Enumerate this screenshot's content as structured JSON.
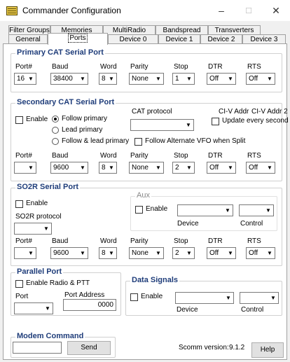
{
  "window": {
    "title": "Commander Configuration",
    "min": "–",
    "max": "☐",
    "close": "✕"
  },
  "tabs_back": [
    "Filter Groups",
    "Memories",
    "MultiRadio",
    "Bandspread",
    "Transverters"
  ],
  "tabs_front": [
    "General",
    "Ports",
    "Device 0",
    "Device 1",
    "Device 2",
    "Device 3"
  ],
  "primary": {
    "title": "Primary CAT Serial Port",
    "labels": [
      "Port#",
      "Baud",
      "Word",
      "Parity",
      "Stop",
      "DTR",
      "RTS"
    ],
    "values": [
      "16",
      "38400",
      "8",
      "None",
      "1",
      "Off",
      "Off"
    ]
  },
  "secondary": {
    "title": "Secondary CAT Serial Port",
    "enable": "Enable",
    "follow_primary": "Follow primary",
    "lead_primary": "Lead primary",
    "follow_lead": "Follow & lead primary",
    "cat_protocol": "CAT protocol",
    "civ1": "CI-V Addr",
    "civ2": "CI-V Addr 2",
    "update": "Update every second",
    "follow_vfo": "Follow Alternate VFO when Split",
    "labels": [
      "Port#",
      "Baud",
      "Word",
      "Parity",
      "Stop",
      "DTR",
      "RTS"
    ],
    "values": [
      "",
      "9600",
      "8",
      "None",
      "2",
      "Off",
      "Off"
    ]
  },
  "so2r": {
    "title": "SO2R Serial Port",
    "enable": "Enable",
    "protocol": "SO2R protocol",
    "aux": "Aux",
    "aux_enable": "Enable",
    "device": "Device",
    "control": "Control",
    "labels": [
      "Port#",
      "Baud",
      "Word",
      "Parity",
      "Stop",
      "DTR",
      "RTS"
    ],
    "values": [
      "",
      "9600",
      "8",
      "None",
      "2",
      "Off",
      "Off"
    ]
  },
  "parallel": {
    "title": "Parallel Port",
    "enable": "Enable Radio & PTT",
    "port": "Port",
    "address_label": "Port Address",
    "address": "0000"
  },
  "data_signals": {
    "title": "Data Signals",
    "enable": "Enable",
    "device": "Device",
    "control": "Control"
  },
  "modem": {
    "title": "Modem Command",
    "send": "Send"
  },
  "scomm": {
    "label": "Scomm version:",
    "version": "9.1.2"
  },
  "help": "Help"
}
